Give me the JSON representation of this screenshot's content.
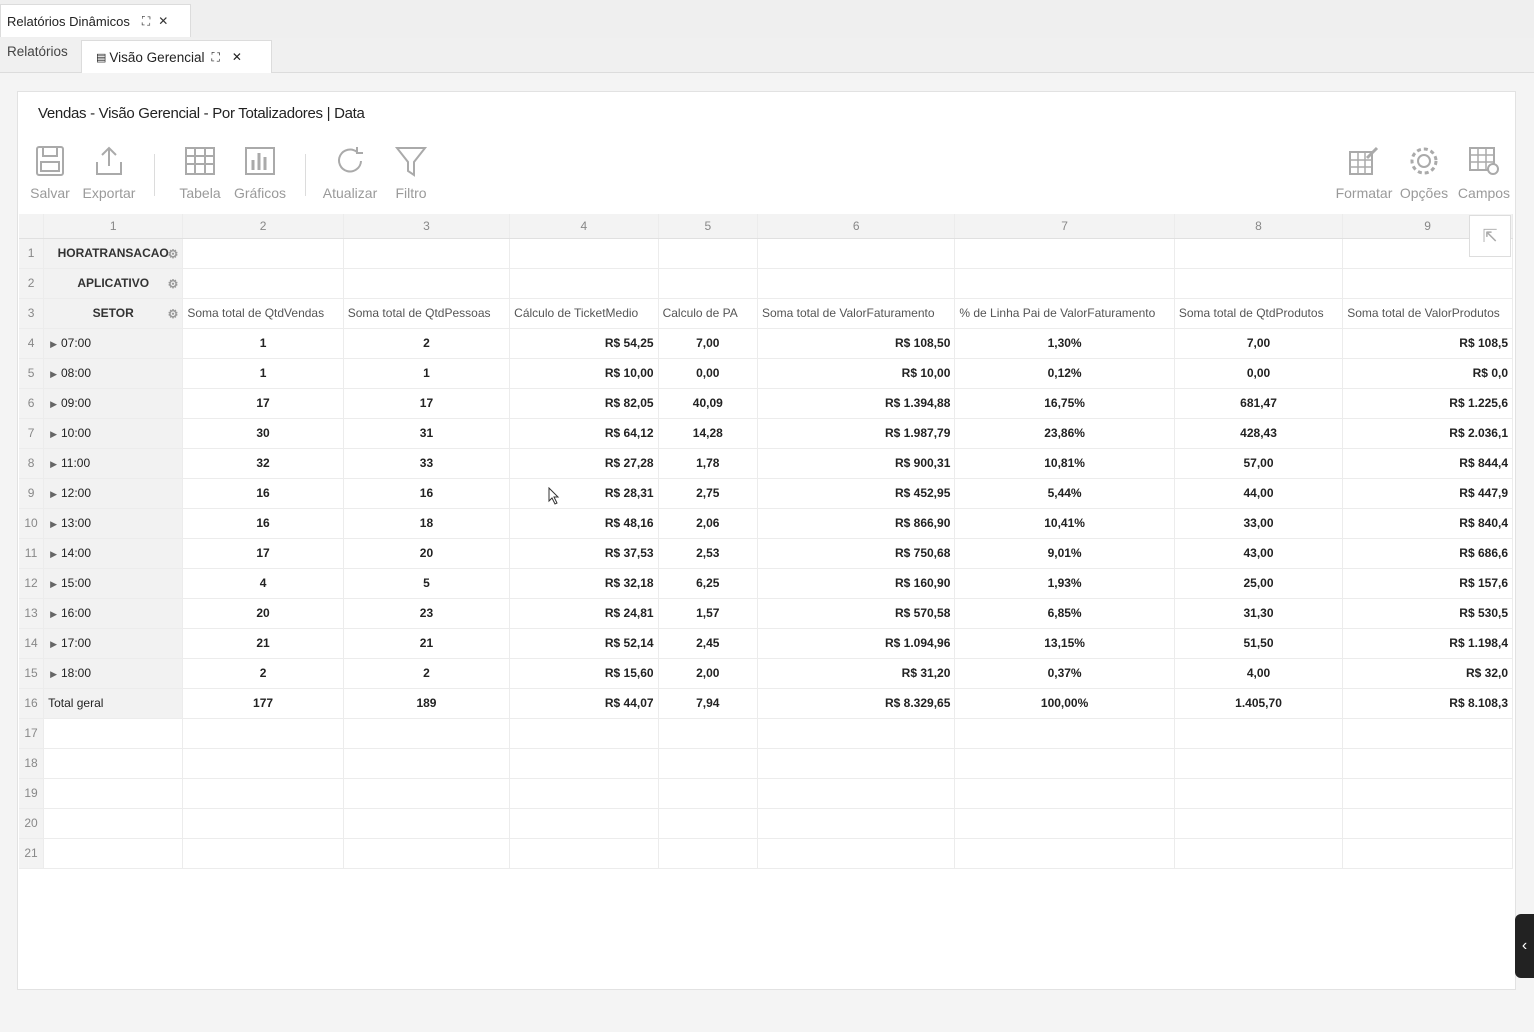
{
  "window_tab": {
    "title": "Relatórios Dinâmicos"
  },
  "tabs": {
    "first": "Relatórios",
    "active": "Visão Gerencial"
  },
  "report": {
    "title": "Vendas - Visão Gerencial - Por Totalizadores | Data"
  },
  "toolbar": {
    "save": "Salvar",
    "export": "Exportar",
    "table": "Tabela",
    "charts": "Gráficos",
    "refresh": "Atualizar",
    "filter": "Filtro",
    "format": "Formatar",
    "options": "Opções",
    "fields": "Campos"
  },
  "grid": {
    "col_numbers": [
      "1",
      "2",
      "3",
      "4",
      "5",
      "6",
      "7",
      "8",
      "9"
    ],
    "row_numbers": [
      "1",
      "2",
      "3",
      "4",
      "5",
      "6",
      "7",
      "8",
      "9",
      "10",
      "11",
      "12",
      "13",
      "14",
      "15",
      "16",
      "17",
      "18",
      "19",
      "20",
      "21"
    ],
    "fields": [
      "HORATRANSACAO",
      "APLICATIVO",
      "SETOR"
    ],
    "headers": [
      "Soma total de QtdVendas",
      "Soma total de QtdPessoas",
      "Cálculo de TicketMedio",
      "Calculo de PA",
      "Soma total de ValorFaturamento",
      "% de Linha Pai de ValorFaturamento",
      "Soma total de QtdProdutos",
      "Soma total de ValorProdutos"
    ],
    "rows": [
      {
        "label": "07:00",
        "vals": [
          "1",
          "2",
          "R$ 54,25",
          "7,00",
          "R$ 108,50",
          "1,30%",
          "7,00",
          "R$ 108,5"
        ]
      },
      {
        "label": "08:00",
        "vals": [
          "1",
          "1",
          "R$ 10,00",
          "0,00",
          "R$ 10,00",
          "0,12%",
          "0,00",
          "R$ 0,0"
        ]
      },
      {
        "label": "09:00",
        "vals": [
          "17",
          "17",
          "R$ 82,05",
          "40,09",
          "R$ 1.394,88",
          "16,75%",
          "681,47",
          "R$ 1.225,6"
        ]
      },
      {
        "label": "10:00",
        "vals": [
          "30",
          "31",
          "R$ 64,12",
          "14,28",
          "R$ 1.987,79",
          "23,86%",
          "428,43",
          "R$ 2.036,1"
        ]
      },
      {
        "label": "11:00",
        "vals": [
          "32",
          "33",
          "R$ 27,28",
          "1,78",
          "R$ 900,31",
          "10,81%",
          "57,00",
          "R$ 844,4"
        ]
      },
      {
        "label": "12:00",
        "vals": [
          "16",
          "16",
          "R$ 28,31",
          "2,75",
          "R$ 452,95",
          "5,44%",
          "44,00",
          "R$ 447,9"
        ]
      },
      {
        "label": "13:00",
        "vals": [
          "16",
          "18",
          "R$ 48,16",
          "2,06",
          "R$ 866,90",
          "10,41%",
          "33,00",
          "R$ 840,4"
        ]
      },
      {
        "label": "14:00",
        "vals": [
          "17",
          "20",
          "R$ 37,53",
          "2,53",
          "R$ 750,68",
          "9,01%",
          "43,00",
          "R$ 686,6"
        ]
      },
      {
        "label": "15:00",
        "vals": [
          "4",
          "5",
          "R$ 32,18",
          "6,25",
          "R$ 160,90",
          "1,93%",
          "25,00",
          "R$ 157,6"
        ]
      },
      {
        "label": "16:00",
        "vals": [
          "20",
          "23",
          "R$ 24,81",
          "1,57",
          "R$ 570,58",
          "6,85%",
          "31,30",
          "R$ 530,5"
        ]
      },
      {
        "label": "17:00",
        "vals": [
          "21",
          "21",
          "R$ 52,14",
          "2,45",
          "R$ 1.094,96",
          "13,15%",
          "51,50",
          "R$ 1.198,4"
        ]
      },
      {
        "label": "18:00",
        "vals": [
          "2",
          "2",
          "R$ 15,60",
          "2,00",
          "R$ 31,20",
          "0,37%",
          "4,00",
          "R$ 32,0"
        ]
      }
    ],
    "total": {
      "label": "Total geral",
      "vals": [
        "177",
        "189",
        "R$ 44,07",
        "7,94",
        "R$ 8.329,65",
        "100,00%",
        "1.405,70",
        "R$ 8.108,3"
      ]
    }
  }
}
